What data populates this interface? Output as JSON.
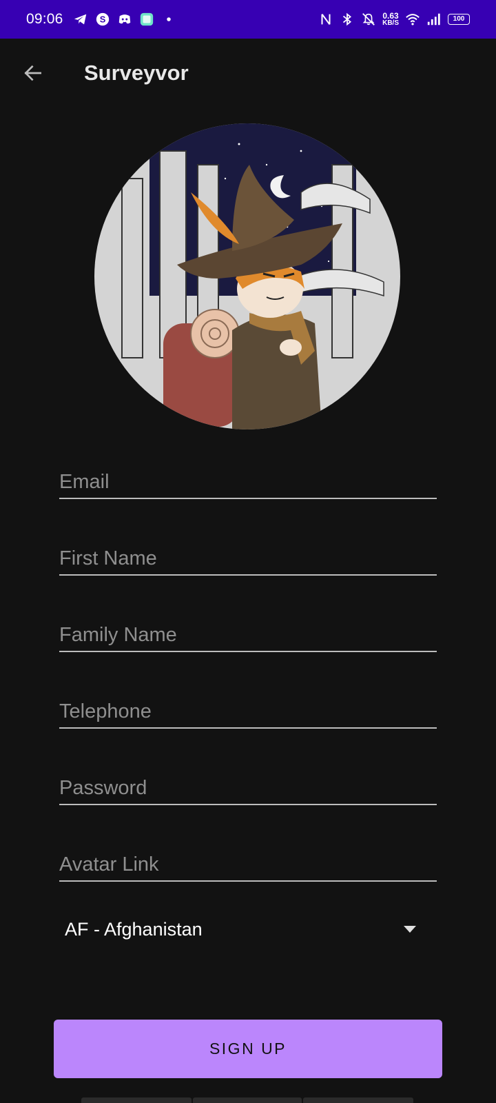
{
  "status_bar": {
    "time": "09:06",
    "network_speed_value": "0.63",
    "network_speed_unit": "KB/S",
    "battery_level": "100"
  },
  "app_bar": {
    "title": "Surveyvor",
    "back_icon": "arrow-left-icon"
  },
  "avatar": {
    "icon": "profile-avatar-illustration"
  },
  "form": {
    "email_placeholder": "Email",
    "first_name_placeholder": "First Name",
    "family_name_placeholder": "Family Name",
    "telephone_placeholder": "Telephone",
    "password_placeholder": "Password",
    "avatar_link_placeholder": "Avatar Link",
    "country_selected": "AF - Afghanistan"
  },
  "actions": {
    "signup_label": "SIGN UP"
  },
  "colors": {
    "status_bar": "#3700b3",
    "background": "#121212",
    "accent": "#bb86fc"
  }
}
